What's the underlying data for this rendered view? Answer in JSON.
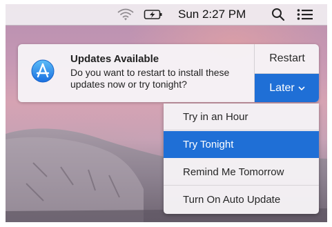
{
  "menubar": {
    "clock": "Sun 2:27 PM",
    "icons": [
      "wifi-icon",
      "battery-charging-icon",
      "spotlight-search-icon",
      "notification-center-icon"
    ]
  },
  "notification": {
    "app_icon": "app-store-icon",
    "title": "Updates Available",
    "body": "Do you want to restart to install these updates now or try tonight?",
    "restart_label": "Restart",
    "later_label": "Later",
    "accent_color": "#1f6fd6"
  },
  "later_menu": {
    "items": [
      {
        "label": "Try in an Hour",
        "selected": false
      },
      {
        "label": "Try Tonight",
        "selected": true
      },
      {
        "label": "Remind Me Tomorrow",
        "selected": false
      },
      {
        "label": "Turn On Auto Update",
        "selected": false
      }
    ]
  }
}
